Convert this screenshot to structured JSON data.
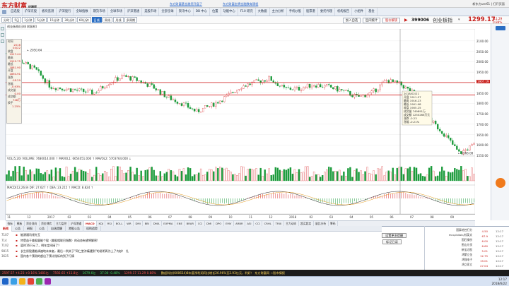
{
  "app": {
    "logo": "东方财富",
    "logo_sub": "终端版",
    "promo_1": "东方财富基金邀您开盘了",
    "promo_2": "东方财富金牌金融教育课程",
    "top_right": "新东方uer61",
    "minimize_label": "打开页面"
  },
  "topnav": {
    "items": [
      "自选股",
      "沪深京股",
      "板块监测",
      "沪深股行",
      "全球指数",
      "期货市场",
      "全球市场",
      "沪深港通",
      "美股市场",
      "全部全球",
      "资讯中心",
      "DB 中心",
      "位置",
      "功能中心",
      "F10 研究",
      "大数据",
      "主力分析",
      "手机炒股",
      "股票港",
      "委托代理",
      "机构报告",
      "小组件",
      "基金"
    ]
  },
  "toolbar": {
    "periods": [
      "分时",
      "5日",
      "1分钟",
      "5分钟",
      "15分钟",
      "30分钟",
      "60分钟",
      "日线",
      "周线",
      "月线",
      "多周期"
    ],
    "active_period": "日线",
    "add_watch": "加入自选",
    "compare": "区间统计",
    "lock": "股价解锁",
    "code": "399006",
    "name": "创业板指",
    "price": "1299.17",
    "change": "11.29",
    "change_pct": "0.88%"
  },
  "chart_title": "创业板指(日线 前复权)",
  "infobox": {
    "rows": [
      {
        "label": "时间",
        "value": "2016"
      },
      {
        "label": "",
        "value": "04/22"
      },
      {
        "label": "收盘",
        "value": "1917.44"
      },
      {
        "label": "最高",
        "value": "1919.75"
      },
      {
        "label": "最低",
        "value": "1881.90"
      },
      {
        "label": "开盘",
        "value": "1894.91"
      },
      {
        "label": "涨跌",
        "value": "-18.29"
      },
      {
        "label": "涨幅",
        "value": "-0.93%"
      },
      {
        "label": "成交量",
        "value": "0.00"
      },
      {
        "label": "成交额",
        "value": "748万"
      },
      {
        "label": "换手",
        "value": "1.25%"
      }
    ]
  },
  "chart_data": {
    "type": "candlestick",
    "y_ticks": [
      2100,
      2050,
      2000,
      1950,
      1900,
      1850,
      1800,
      1750,
      1700,
      1650,
      1600,
      1550
    ],
    "ylim": [
      1520,
      2130
    ],
    "x_ticks": [
      "11",
      "12",
      "2017",
      "02",
      "03",
      "04",
      "05",
      "06",
      "07",
      "08",
      "09",
      "10",
      "11",
      "12",
      "2018",
      "02",
      "03",
      "04",
      "05",
      "06",
      "07",
      "08",
      "09"
    ],
    "h_lines": [
      1900,
      1840
    ],
    "tooltip": [
      "2018/02/21",
      "开盘 1911.57",
      "最高 1916.23",
      "最低 1901.98",
      "收盘 1905.25",
      "成交量 749891万",
      "成交额 1250266万元",
      "涨跌 -0.23",
      "涨幅 -0.21%"
    ],
    "high_label": "← 2050.64",
    "low_label": "← 1566.08",
    "price_levels": [
      "2100.00",
      "2050.00",
      "2000.00",
      "1950.00",
      "1907.19",
      "1850.00",
      "1800.00",
      "1750.00",
      "1700.00",
      "1650.00",
      "1600.00",
      "1550.00"
    ]
  },
  "vol_bar": "VOL(5,20)  VOLUME: 7480014.000 ↑  MAVOL1: 6654051.000 ↑  MAVOL2: 5703764.000 ↓",
  "macd_bar": "MACD(12,26,9)  DIF: 27.627 ↑  DEA: 23.215 ↑  MACD: 8.824 ↑",
  "indicator_tabs": [
    "指标",
    "模板",
    "资金流向",
    "资金博弈",
    "主力监控",
    "沪深港通",
    "MACD",
    "KDJ",
    "RSI",
    "BOLL",
    "WR",
    "DMI",
    "BBI",
    "DMA",
    "EXPMA",
    "ENE",
    "BRAR",
    "CCI",
    "DMI",
    "DPO",
    "EMV",
    "ARBR",
    "ASI",
    "CCI",
    "CRHL",
    "TRIX",
    "主力动向",
    "超买超卖",
    "量比分析",
    "筹码"
  ],
  "active_indicator": "MACD",
  "news": {
    "tabs": [
      "新闻",
      "公告",
      "研报",
      "公告",
      "自选提醒",
      "港股公告",
      "机构追踪"
    ],
    "active_tab": "新闻",
    "refresh_button": "设置更多提醒",
    "read_button": "标记已读",
    "rows": [
      {
        "id": "7107",
        "text": "能源通讯领先互"
      },
      {
        "id": "714",
        "text": "特受益于美股量能个股（美股相联巴指数）的动态有望将解密!"
      },
      {
        "id": "7102",
        "text": "篮时16只元了，明年定间接了？"
      },
      {
        "id": "9815",
        "text": "长生质股遇临调遍地未来者，最后一例关于\"同仁堂济痛遇到\"的说明再为上了内核！ 扎"
      },
      {
        "id": "3625",
        "text": "国内各个预测的超出了预计指标的到了行情"
      }
    ]
  },
  "ticks": {
    "rows": [
      {
        "name": "国泰地控打分",
        "price": "4.50",
        "time": "12:17"
      },
      {
        "name": "mcq-ibilolc/综英文",
        "price": "67.9",
        "time": "12:17"
      },
      {
        "name": "国石钢份",
        "price": "6.00",
        "time": "12:17"
      },
      {
        "name": "图山元伐",
        "price": "6.60",
        "time": "12:17"
      },
      {
        "name": "新宝沿股",
        "price": "5.01",
        "time": "12:17"
      },
      {
        "name": "鸿蒙立金",
        "price": "12.75",
        "time": "12:17"
      },
      {
        "name": "鸿强电子",
        "price": "19.01",
        "time": "12:17"
      },
      {
        "name": "鸿立家立",
        "price": "27.04",
        "time": "12:17"
      }
    ]
  },
  "status": {
    "items": [
      {
        "a": "2597.57",
        "b": "↑4.23",
        "c": "+0.16%",
        "d": "1481亿",
        "cls": "r"
      },
      {
        "a": "7592.65",
        "b": "↑11.8亿",
        "c": "",
        "d": "",
        "cls": "r"
      },
      {
        "a": "1679.6亿",
        "b": "",
        "c": "",
        "d": "",
        "cls": "g"
      },
      {
        "a": "37.00",
        "b": "-0.48%",
        "c": "",
        "d": "",
        "cls": "g"
      },
      {
        "a": "1299.17",
        "b": "11.29",
        "c": "0.88%",
        "d": "",
        "cls": "r"
      }
    ],
    "ticker": "鹏起科技(600614)8年度净利润同比增长26.96%至2.93亿元，利好！ 东方财富网 ☆股市情报"
  },
  "taskbar": {
    "time": "12:17",
    "date": "2018/6/22"
  }
}
